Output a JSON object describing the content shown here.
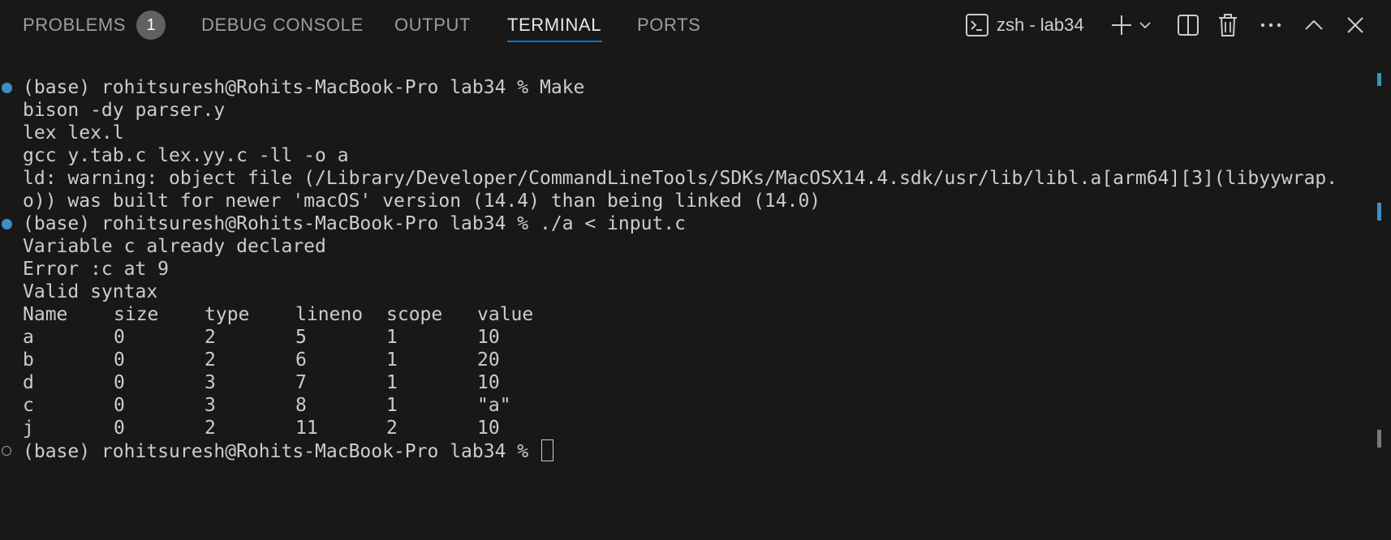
{
  "tabs": [
    {
      "label": "PROBLEMS",
      "badge": "1"
    },
    {
      "label": "DEBUG CONSOLE"
    },
    {
      "label": "OUTPUT"
    },
    {
      "label": "TERMINAL",
      "active": true
    },
    {
      "label": "PORTS"
    }
  ],
  "toolbar": {
    "terminal_name": "zsh - lab34",
    "icons": [
      "terminal-icon",
      "plus-icon",
      "chevron-down-icon",
      "split-icon",
      "trash-icon",
      "more-icon",
      "chevron-up-icon",
      "close-icon"
    ]
  },
  "terminal": {
    "lines": [
      "(base) rohitsuresh@Rohits-MacBook-Pro lab34 % Make",
      "bison -dy parser.y",
      "lex lex.l",
      "gcc y.tab.c lex.yy.c -ll -o a",
      "ld: warning: object file (/Library/Developer/CommandLineTools/SDKs/MacOSX14.4.sdk/usr/lib/libl.a[arm64][3](libyywrap.",
      "o)) was built for newer 'macOS' version (14.4) than being linked (14.0)",
      "(base) rohitsuresh@Rohits-MacBook-Pro lab34 % ./a < input.c",
      "Variable c already declared",
      "Error :c at 9",
      "Valid syntax"
    ],
    "table": {
      "headers": [
        "Name",
        "size",
        "type",
        "lineno",
        "scope",
        "value"
      ],
      "rows": [
        [
          "a",
          "0",
          "2",
          "5",
          "1",
          "10"
        ],
        [
          "b",
          "0",
          "2",
          "6",
          "1",
          "20"
        ],
        [
          "d",
          "0",
          "3",
          "7",
          "1",
          "10"
        ],
        [
          "c",
          "0",
          "3",
          "8",
          "1",
          "\"a\""
        ],
        [
          "j",
          "0",
          "2",
          "11",
          "2",
          "10"
        ]
      ]
    },
    "prompt": "(base) rohitsuresh@Rohits-MacBook-Pro lab34 % "
  },
  "colors": {
    "background": "#181818",
    "accent": "#0078d4",
    "command_ok_mark": "#3d8fc6"
  }
}
